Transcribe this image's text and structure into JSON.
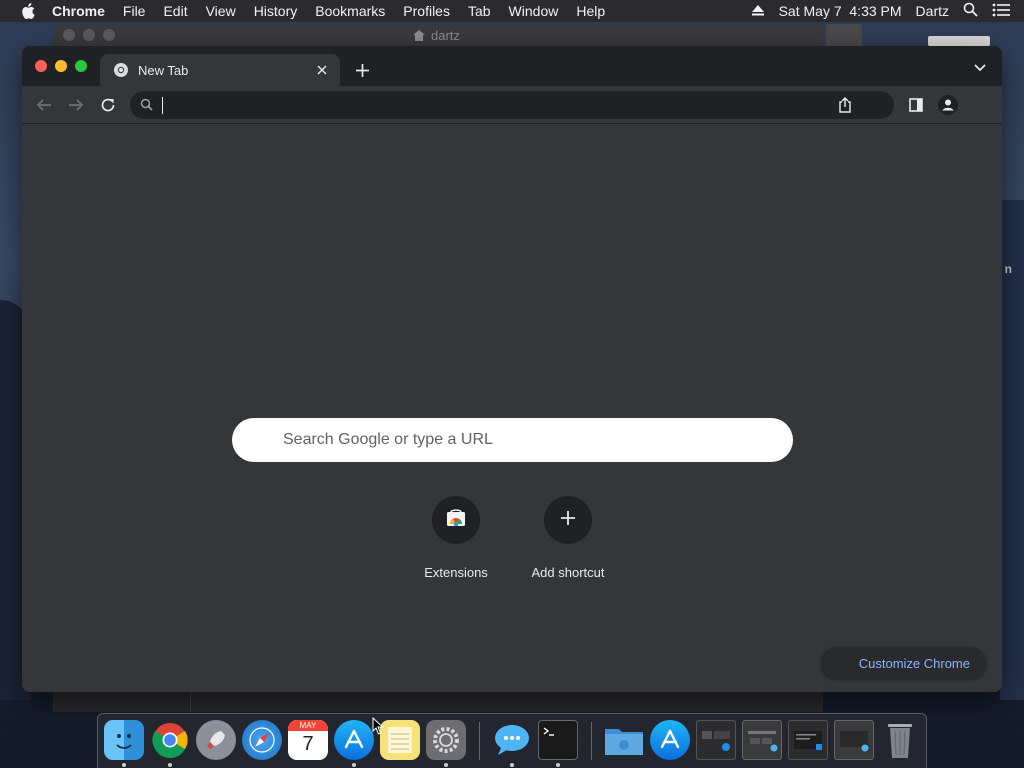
{
  "menubar": {
    "app_name": "Chrome",
    "items": [
      "File",
      "Edit",
      "View",
      "History",
      "Bookmarks",
      "Profiles",
      "Tab",
      "Window",
      "Help"
    ],
    "datetime": "Sat May 7  4:33 PM",
    "user": "Dartz"
  },
  "background_window": {
    "title": "dartz"
  },
  "desktop": {
    "edge_text": "n"
  },
  "tab": {
    "title": "New Tab"
  },
  "omnibox": {
    "value": "",
    "placeholder": ""
  },
  "ntp": {
    "search_placeholder": "Search Google or type a URL",
    "shortcuts": [
      {
        "label": "Extensions",
        "icon": "chrome-web-store-icon"
      },
      {
        "label": "Add shortcut",
        "icon": "plus-icon"
      }
    ],
    "customize_label": "Customize Chrome"
  },
  "dock": {
    "apps": [
      "finder-icon",
      "chrome-icon",
      "launchpad-icon",
      "safari-icon",
      "calendar-icon",
      "app-store-icon",
      "notes-icon",
      "system-preferences-icon",
      "messages-icon",
      "terminal-icon",
      "downloads-folder-icon",
      "app-store-window-icon",
      "window-thumbnail-icon",
      "window-thumbnail-icon",
      "window-thumbnail-icon",
      "window-thumbnail-icon",
      "trash-icon"
    ],
    "calendar": {
      "month": "MAY",
      "day": "7"
    }
  },
  "colors": {
    "accent_link": "#8ab4f8",
    "frame": "#202124",
    "toolbar": "#35363a"
  }
}
